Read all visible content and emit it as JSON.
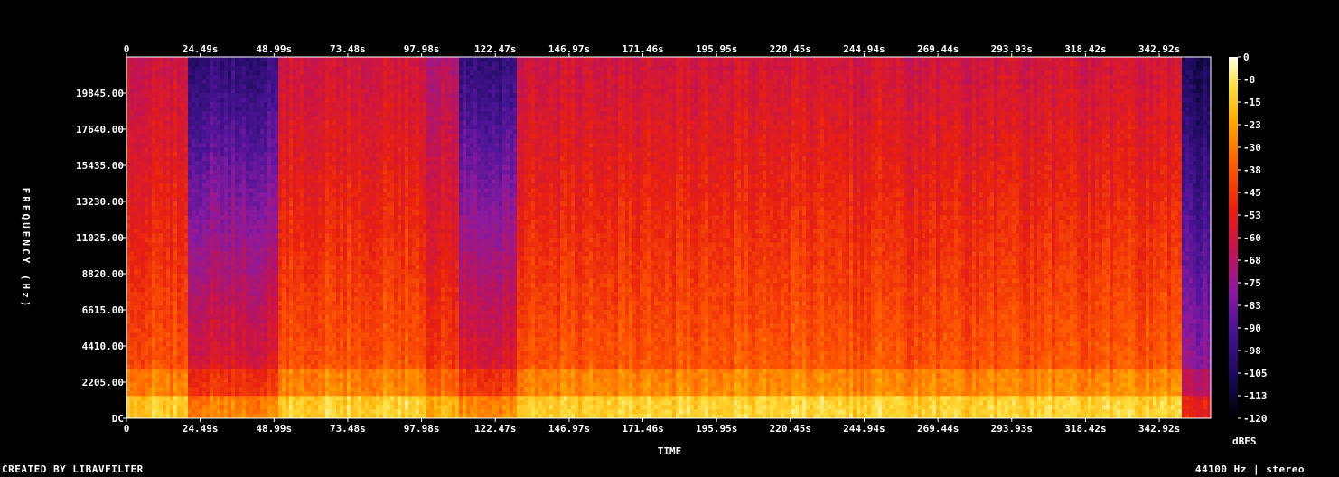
{
  "chart_data": {
    "type": "heatmap",
    "title": "",
    "xlabel": "TIME",
    "ylabel": "FREQUENCY (Hz)",
    "x_ticks": [
      "0",
      "24.49s",
      "48.99s",
      "73.48s",
      "97.98s",
      "122.47s",
      "146.97s",
      "171.46s",
      "195.95s",
      "220.45s",
      "244.94s",
      "269.44s",
      "293.93s",
      "318.42s",
      "342.92s"
    ],
    "x_tick_values_s": [
      0,
      24.49,
      48.99,
      73.48,
      97.98,
      122.47,
      146.97,
      171.46,
      195.95,
      220.45,
      244.94,
      269.44,
      293.93,
      318.42,
      342.92
    ],
    "xlim": [
      0,
      360
    ],
    "y_ticks": [
      "DC",
      "2205.00",
      "4410.00",
      "6615.00",
      "8820.00",
      "11025.00",
      "13230.00",
      "15435.00",
      "17640.00",
      "19845.00"
    ],
    "y_tick_values_hz": [
      0,
      2205,
      4410,
      6615,
      8820,
      11025,
      13230,
      15435,
      17640,
      19845
    ],
    "ylim": [
      0,
      22050
    ],
    "colorbar": {
      "label": "dBFS",
      "ticks": [
        "0",
        "-8",
        "-15",
        "-23",
        "-30",
        "-38",
        "-45",
        "-53",
        "-60",
        "-68",
        "-75",
        "-83",
        "-90",
        "-98",
        "-105",
        "-113",
        "-120"
      ],
      "range": [
        -120,
        0
      ],
      "colors": [
        "#000000",
        "#1a0a5a",
        "#4b1496",
        "#8a1aa0",
        "#c8144a",
        "#e82010",
        "#ff5a00",
        "#ffa800",
        "#ffe040",
        "#fffff0"
      ]
    },
    "segments_approx": [
      {
        "from_s": 0,
        "to_s": 13,
        "level": "loud"
      },
      {
        "from_s": 13,
        "to_s": 20,
        "level": "loud"
      },
      {
        "from_s": 20,
        "to_s": 50,
        "level": "quiet-high-freq"
      },
      {
        "from_s": 50,
        "to_s": 100,
        "level": "loud"
      },
      {
        "from_s": 100,
        "to_s": 111,
        "level": "medium"
      },
      {
        "from_s": 111,
        "to_s": 130,
        "level": "quiet-high-freq"
      },
      {
        "from_s": 130,
        "to_s": 350,
        "level": "loud"
      },
      {
        "from_s": 350,
        "to_s": 360,
        "level": "fade-out"
      }
    ]
  },
  "footer": {
    "left": "CREATED BY LIBAVFILTER",
    "right": "44100 Hz | stereo"
  }
}
